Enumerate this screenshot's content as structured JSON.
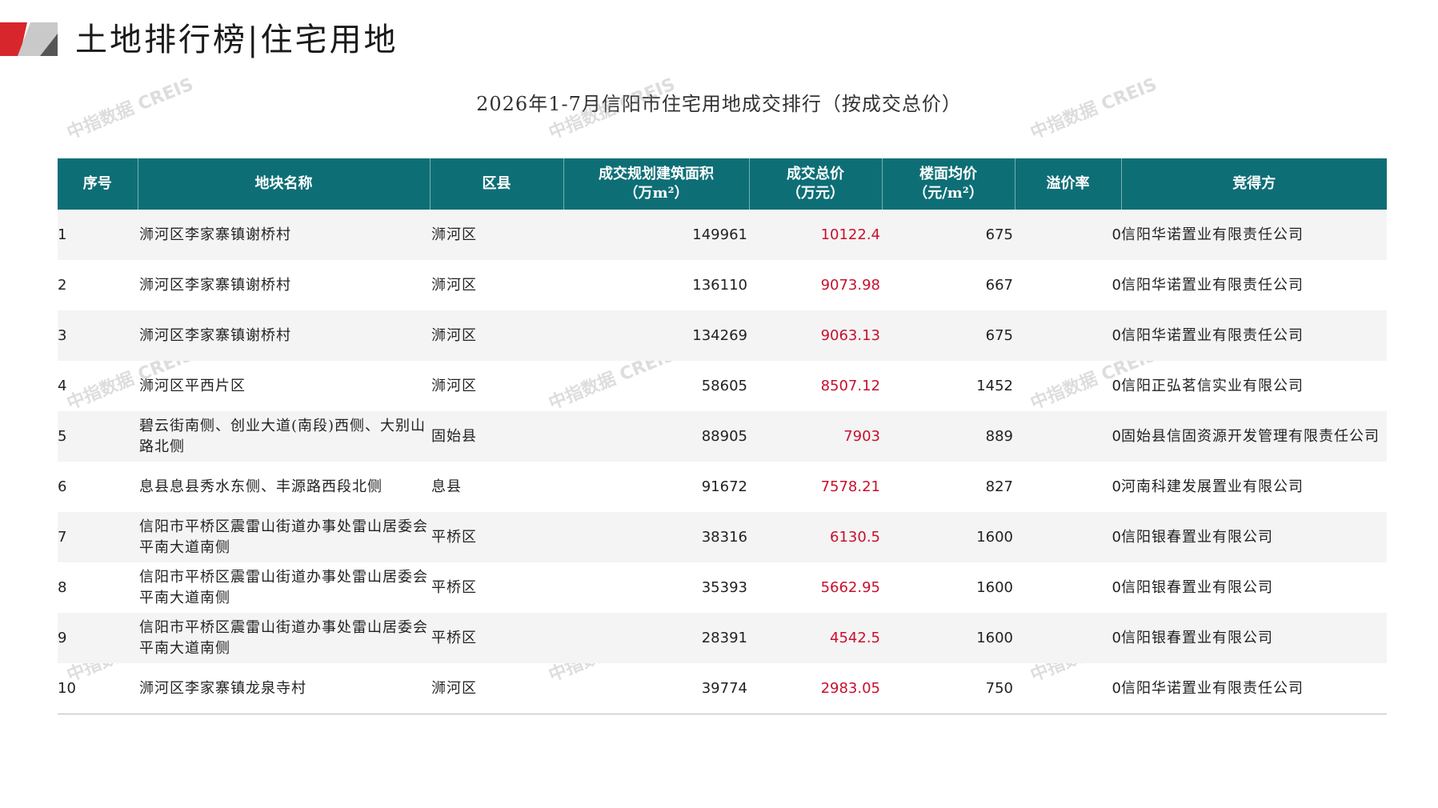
{
  "header": {
    "title": "土地排行榜|住宅用地"
  },
  "table_title": "2026年1-7月信阳市住宅用地成交排行（按成交总价）",
  "watermark": "中指数据 CREIS",
  "columns": [
    {
      "l1": "序号",
      "l2": ""
    },
    {
      "l1": "地块名称",
      "l2": ""
    },
    {
      "l1": "区县",
      "l2": ""
    },
    {
      "l1": "成交规划建筑面积",
      "l2": "（万m²）"
    },
    {
      "l1": "成交总价",
      "l2": "（万元）"
    },
    {
      "l1": "楼面均价",
      "l2": "（元/m²）"
    },
    {
      "l1": "溢价率",
      "l2": ""
    },
    {
      "l1": "竞得方",
      "l2": ""
    }
  ],
  "rows": [
    {
      "rank": "1",
      "name": "浉河区李家寨镇谢桥村",
      "district": "浉河区",
      "area": "149961",
      "price": "10122.4",
      "unit": "675",
      "premium": "0",
      "bidder": "信阳华诺置业有限责任公司"
    },
    {
      "rank": "2",
      "name": "浉河区李家寨镇谢桥村",
      "district": "浉河区",
      "area": "136110",
      "price": "9073.98",
      "unit": "667",
      "premium": "0",
      "bidder": "信阳华诺置业有限责任公司"
    },
    {
      "rank": "3",
      "name": "浉河区李家寨镇谢桥村",
      "district": "浉河区",
      "area": "134269",
      "price": "9063.13",
      "unit": "675",
      "premium": "0",
      "bidder": "信阳华诺置业有限责任公司"
    },
    {
      "rank": "4",
      "name": "浉河区平西片区",
      "district": "浉河区",
      "area": "58605",
      "price": "8507.12",
      "unit": "1452",
      "premium": "0",
      "bidder": "信阳正弘茗信实业有限公司"
    },
    {
      "rank": "5",
      "name": "碧云街南侧、创业大道(南段)西侧、大别山路北侧",
      "district": "固始县",
      "area": "88905",
      "price": "7903",
      "unit": "889",
      "premium": "0",
      "bidder": "固始县信固资源开发管理有限责任公司"
    },
    {
      "rank": "6",
      "name": "息县息县秀水东侧、丰源路西段北侧",
      "district": "息县",
      "area": "91672",
      "price": "7578.21",
      "unit": "827",
      "premium": "0",
      "bidder": "河南科建发展置业有限公司"
    },
    {
      "rank": "7",
      "name": "信阳市平桥区震雷山街道办事处雷山居委会平南大道南侧",
      "district": "平桥区",
      "area": "38316",
      "price": "6130.5",
      "unit": "1600",
      "premium": "0",
      "bidder": "信阳银春置业有限公司"
    },
    {
      "rank": "8",
      "name": "信阳市平桥区震雷山街道办事处雷山居委会平南大道南侧",
      "district": "平桥区",
      "area": "35393",
      "price": "5662.95",
      "unit": "1600",
      "premium": "0",
      "bidder": "信阳银春置业有限公司"
    },
    {
      "rank": "9",
      "name": "信阳市平桥区震雷山街道办事处雷山居委会平南大道南侧",
      "district": "平桥区",
      "area": "28391",
      "price": "4542.5",
      "unit": "1600",
      "premium": "0",
      "bidder": "信阳银春置业有限公司"
    },
    {
      "rank": "10",
      "name": "浉河区李家寨镇龙泉寺村",
      "district": "浉河区",
      "area": "39774",
      "price": "2983.05",
      "unit": "750",
      "premium": "0",
      "bidder": "信阳华诺置业有限责任公司"
    }
  ],
  "colors": {
    "header_bg": "#0e6e76",
    "price_text": "#c8102e",
    "accent_red": "#d7262c"
  }
}
